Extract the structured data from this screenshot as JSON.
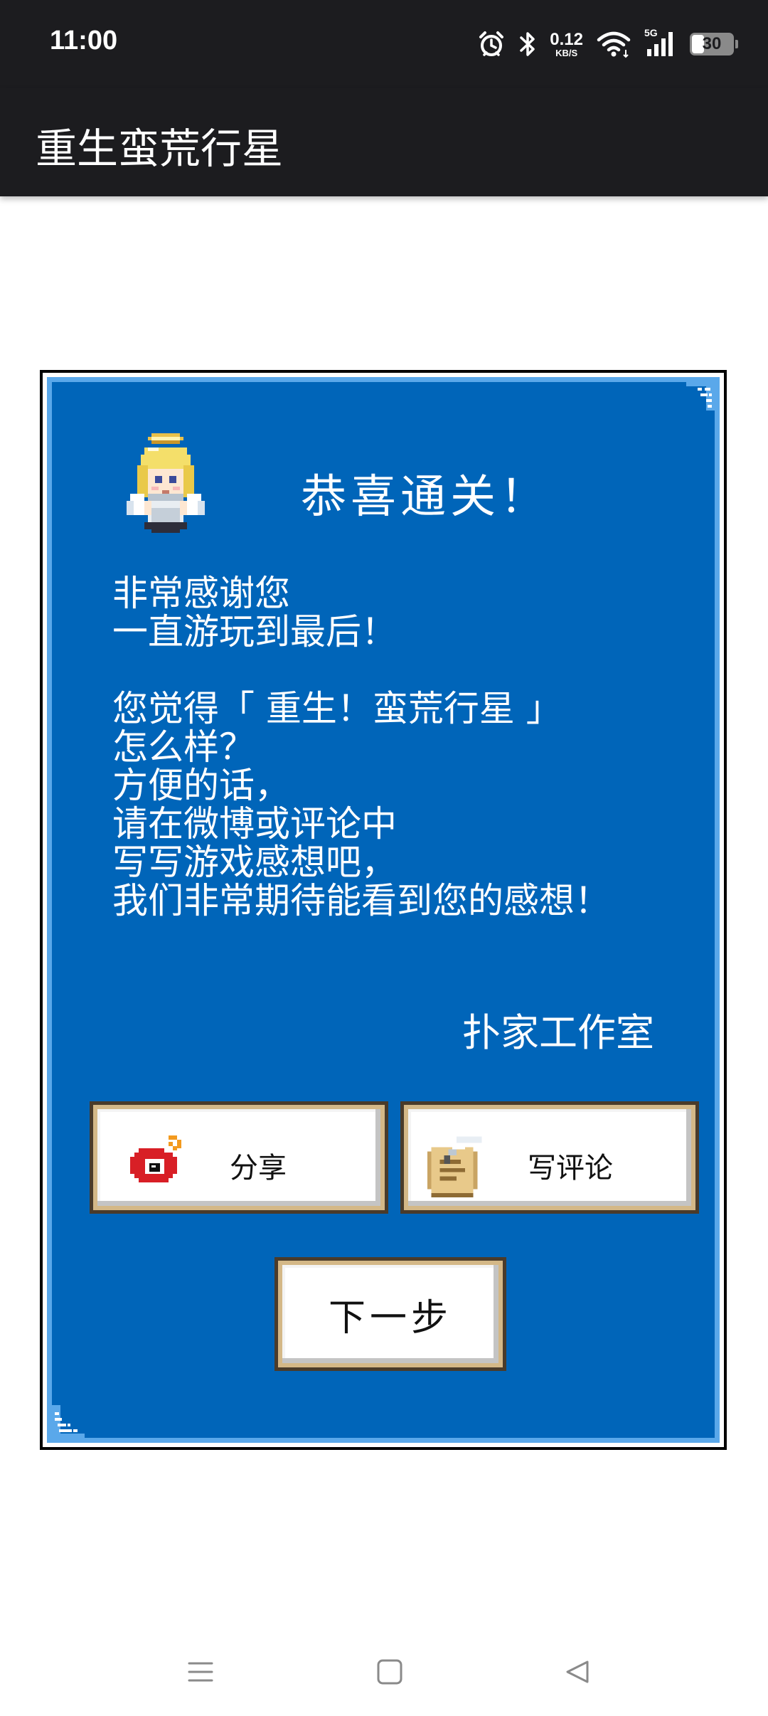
{
  "status_bar": {
    "time": "11:00",
    "network_speed_value": "0.12",
    "network_speed_unit": "KB/S",
    "signal_label": "5G",
    "battery": "30",
    "icons": [
      "alarm-icon",
      "bluetooth-icon",
      "wifi-icon",
      "cell-signal-icon",
      "battery-icon"
    ]
  },
  "app_bar": {
    "title": "重生蛮荒行星"
  },
  "dialog": {
    "title": "恭喜通关！",
    "message_lines": [
      "非常感谢您",
      "一直游玩到最后！",
      "",
      "您觉得「 重生！蛮荒行星 」",
      "怎么样？",
      "方便的话，",
      "请在微博或评论中",
      "写写游戏感想吧，",
      "我们非常期待能看到您的感想！"
    ],
    "signature": "扑家工作室",
    "buttons": {
      "share": "分享",
      "review": "写评论",
      "next": "下一步"
    },
    "colors": {
      "panel": "#0065b9",
      "panel_border": "#5aa8ea",
      "button_border": "#d4b887"
    }
  },
  "nav_bar": {
    "icons": [
      "menu-icon",
      "home-icon",
      "back-icon"
    ]
  }
}
